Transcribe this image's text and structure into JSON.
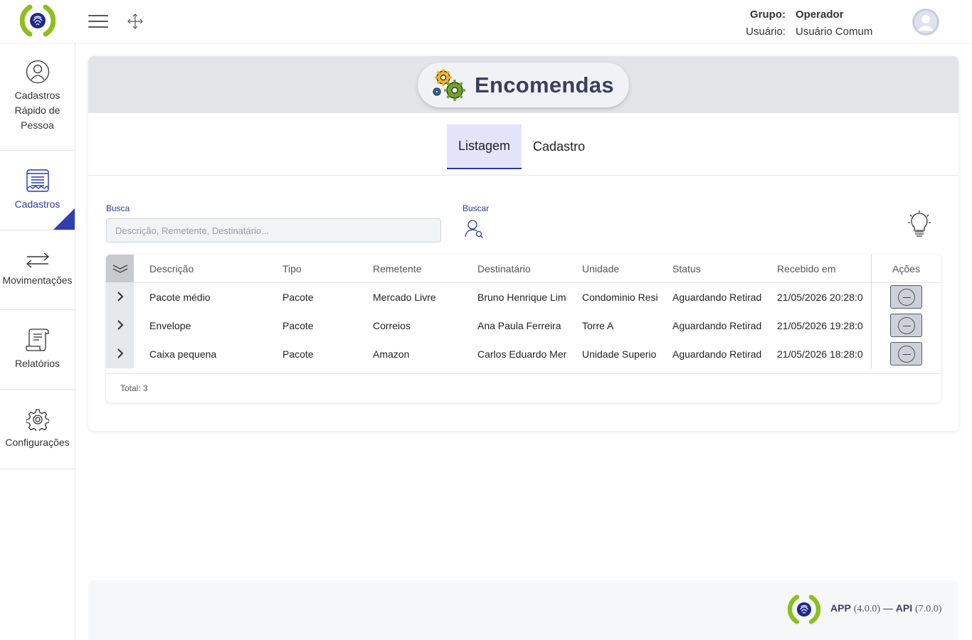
{
  "header": {
    "group_label": "Grupo:",
    "group_value": "Operador",
    "user_label": "Usuário:",
    "user_value": "Usuário Comum"
  },
  "sidebar": {
    "items": [
      {
        "label": "Cadastros Rápido de Pessoa",
        "icon": "user-circle-icon"
      },
      {
        "label": "Cadastros",
        "icon": "document-list-icon",
        "active": true
      },
      {
        "label": "Movimentações",
        "icon": "transfer-arrows-icon"
      },
      {
        "label": "Relatórios",
        "icon": "report-scroll-icon"
      },
      {
        "label": "Configurações",
        "icon": "gear-icon"
      }
    ]
  },
  "page": {
    "title": "Encomendas",
    "title_icon": "gears-icon",
    "tabs": [
      {
        "label": "Listagem",
        "active": true
      },
      {
        "label": "Cadastro",
        "active": false
      }
    ]
  },
  "search": {
    "label": "Busca",
    "placeholder": "Descrição, Remetente, Destinatário...",
    "value": "",
    "button_label": "Buscar"
  },
  "table": {
    "columns": [
      "Descrição",
      "Tipo",
      "Remetente",
      "Destinatário",
      "Unidade",
      "Status",
      "Recebido em"
    ],
    "actions_label": "Ações",
    "rows": [
      [
        "Pacote médio",
        "Pacote",
        "Mercado Livre",
        "Bruno Henrique Lim",
        "Condominio Resi",
        "Aguardando Retirad",
        "21/05/2026 20:28:0"
      ],
      [
        "Envelope",
        "Pacote",
        "Correios",
        "Ana Paula Ferreira",
        "Torre A",
        "Aguardando Retirad",
        "21/05/2026 19:28:0"
      ],
      [
        "Caixa pequena",
        "Pacote",
        "Amazon",
        "Carlos Eduardo Mer",
        "Unidade Superio",
        "Aguardando Retirad",
        "21/05/2026 18:28:0"
      ]
    ],
    "total_label": "Total: 3"
  },
  "footer": {
    "app_label": "APP",
    "app_version": "(4.0.0)",
    "separator": "—",
    "api_label": "API",
    "api_version": "(7.0.0)"
  },
  "colors": {
    "accent": "#2b3a9e",
    "logo_green": "#8dbf1f",
    "tab_active_bg": "#e3e4fa"
  }
}
